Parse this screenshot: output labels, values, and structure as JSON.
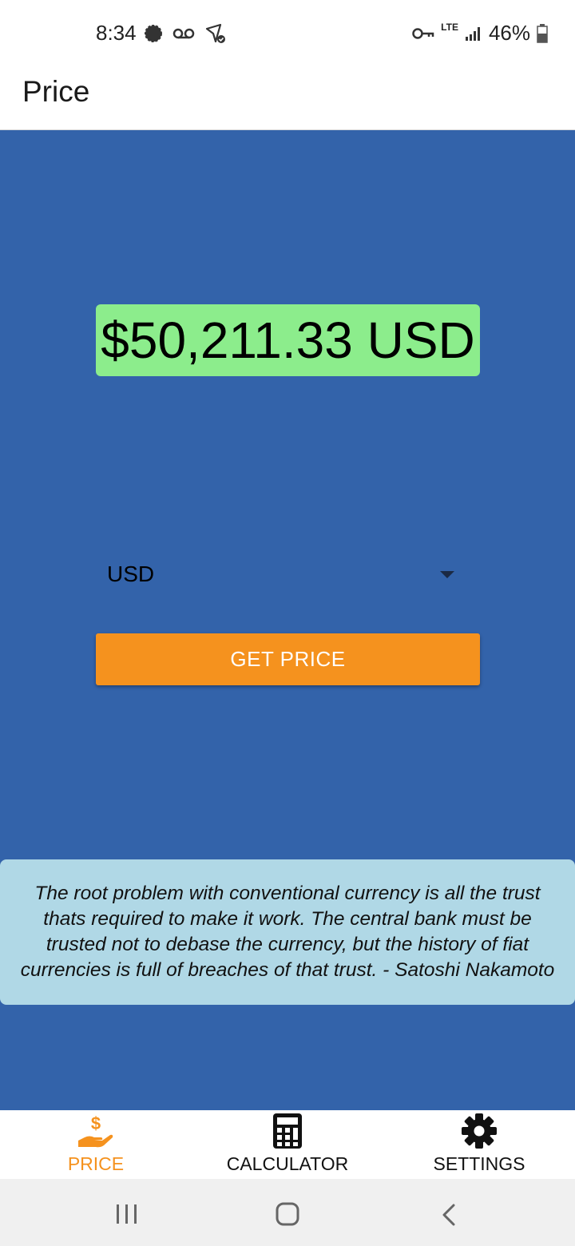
{
  "status_bar": {
    "time": "8:34",
    "network": "LTE",
    "battery": "46%"
  },
  "app_bar": {
    "title": "Price"
  },
  "price_display": {
    "value": "$50,211.33 USD"
  },
  "currency_select": {
    "selected": "USD"
  },
  "get_price_button": {
    "label": "GET PRICE"
  },
  "quote": {
    "text": "The root problem with conventional currency is all the trust thats required to make it work. The central bank must be trusted not to debase the currency, but the history of fiat currencies is full of breaches of that trust. - Satoshi Nakamoto"
  },
  "bottom_nav": {
    "items": [
      {
        "label": "PRICE",
        "icon": "hand-dollar-icon"
      },
      {
        "label": "CALCULATOR",
        "icon": "calculator-icon"
      },
      {
        "label": "SETTINGS",
        "icon": "gear-icon"
      }
    ]
  },
  "colors": {
    "accent": "#f5921e",
    "background": "#3363aa",
    "price_bg": "#8ced8c",
    "quote_bg": "#b0d8e6"
  }
}
